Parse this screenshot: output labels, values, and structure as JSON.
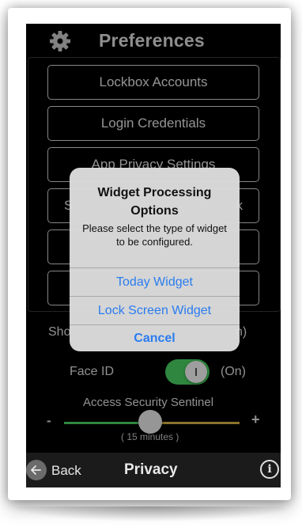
{
  "header": {
    "title": "Preferences",
    "icon": "gear-icon"
  },
  "preferences": [
    {
      "label": "Lockbox Accounts"
    },
    {
      "label": "Login Credentials"
    },
    {
      "label": "App Privacy Settings"
    },
    {
      "label": "S",
      "label_right": "k"
    },
    {
      "label": ""
    },
    {
      "label": ""
    }
  ],
  "rows": {
    "show_left": "Sho",
    "show_right": "n)",
    "face_id_label": "Face ID",
    "face_id_state": "(On)",
    "face_id_on": true
  },
  "sentinel": {
    "label": "Access Security Sentinel",
    "minus": "-",
    "plus": "+",
    "value_text": "( 15 minutes )",
    "position_fraction": 0.42
  },
  "toolbar": {
    "back_label": "Back",
    "title": "Privacy",
    "info_icon": "info-icon",
    "info_glyph": "i"
  },
  "alert": {
    "title": "Widget Processing Options",
    "message": "Please select the type of widget to be configured.",
    "buttons": [
      {
        "label": "Today Widget"
      },
      {
        "label": "Lock Screen Widget"
      },
      {
        "label": "Cancel"
      }
    ]
  },
  "colors": {
    "accent_blue": "#2a7cf0",
    "toggle_green": "#4cd964",
    "slider_left": "#4cd964",
    "slider_right": "#e0b84a"
  }
}
